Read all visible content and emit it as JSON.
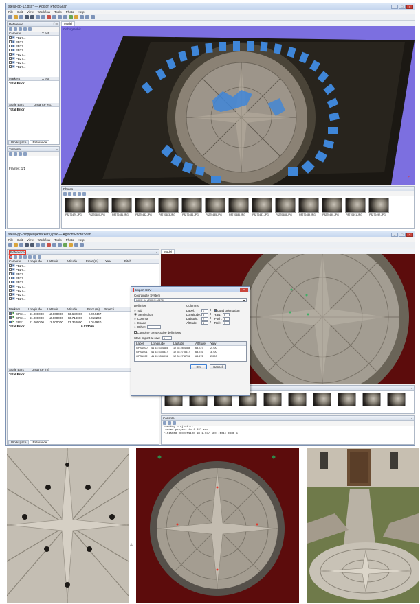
{
  "window1": {
    "title": "stella-pp-12.psx* — Agisoft PhotoScan",
    "menu": [
      "File",
      "Edit",
      "View",
      "Workflow",
      "Tools",
      "Photo",
      "Help"
    ],
    "reference_panel": {
      "title": "Reference",
      "cameras_header": [
        "Cameras",
        "X est"
      ],
      "cameras": [
        "PB27...",
        "PB27...",
        "PB27...",
        "PB27...",
        "PB27...",
        "PB27...",
        "PB27...",
        "PB27..."
      ],
      "markers_header": [
        "Markers",
        "X est"
      ],
      "total_error": "Total Error",
      "scale_header": [
        "Scale Bars",
        "Distance est."
      ],
      "scale_total": "Total Error",
      "tabs": [
        "Workspace",
        "Reference"
      ]
    },
    "timeline": {
      "title": "Timeline",
      "frames": "Frames: 1/1"
    },
    "model": {
      "tab": "Model",
      "label": "Orthographic"
    },
    "photos": {
      "title": "Photos",
      "files": [
        "P8270479.JPG",
        "P8270480.JPG",
        "P8270481.JPG",
        "P8270482.JPG",
        "P8270483.JPG",
        "P8270484.JPG",
        "P8270485.JPG",
        "P8270486.JPG",
        "P8270487.JPG",
        "P8270488.JPG",
        "P8270489.JPG",
        "P8270490.JPG",
        "P8270491.JPG",
        "P8270492.JPG"
      ]
    }
  },
  "window2": {
    "title": "stella-pp-cropped(4markers).psx — Agisoft PhotoScan",
    "reference_panel": {
      "title": "Reference",
      "cameras_columns": [
        "Cameras",
        "Longitude",
        "Latitude",
        "Altitude",
        "Error (m)",
        "Yaw",
        "Pitch"
      ],
      "cameras": [
        "PB27...",
        "PB27...",
        "PB27...",
        "PB27...",
        "PB27...",
        "PB27...",
        "PB27...",
        "PB27...",
        "PB27..."
      ],
      "markers_columns": [
        "Markers",
        "Longitude",
        "Latitude",
        "Altitude",
        "Error (m)",
        "Projecti"
      ],
      "markers": [
        {
          "name": "GPS1...",
          "lon": "41.000000",
          "lat": "12.000000",
          "alt": "63.682000",
          "err": "0.024447"
        },
        {
          "name": "GPS1...",
          "lon": "41.000000",
          "lat": "12.000000",
          "alt": "63.718000",
          "err": "0.018240"
        },
        {
          "name": "GPS1...",
          "lon": "41.000000",
          "lat": "12.000000",
          "alt": "63.362000",
          "err": "0.014940"
        }
      ],
      "total_error_label": "Total Error",
      "total_error_value": "0.023059",
      "scale_columns": [
        "Scale Bars",
        "Distance (m)"
      ],
      "scale_total": "Total Error",
      "tabs": [
        "Workspace",
        "Reference"
      ]
    },
    "model_tab": "Model",
    "console": {
      "title": "Console",
      "lines": [
        "Loading project...",
        "Loaded project in 1.037 sec",
        "Finished processing in 1.037 sec (exit code 1)"
      ]
    },
    "import_dialog": {
      "title": "Import CSV",
      "coordinate_system_label": "Coordinate System",
      "coordinate_system_value": "WGS 84 (EPSG::4326)",
      "delimiter_label": "Delimiter",
      "delimiters": [
        "Tab",
        "Semicolon",
        "Comma",
        "Space",
        "Other:"
      ],
      "combine_label": "Combine consecutive delimiters",
      "columns_label": "Columns",
      "columns": [
        {
          "label": "Label:",
          "value": "1",
          "right_label": "Load orientation",
          "right_value": ""
        },
        {
          "label": "Longitude:",
          "value": "3",
          "right_label": "Yaw:",
          "right_value": "5"
        },
        {
          "label": "Latitude:",
          "value": "2",
          "right_label": "Pitch:",
          "right_value": "6"
        },
        {
          "label": "Altitude:",
          "value": "4",
          "right_label": "Roll:",
          "right_value": "7"
        }
      ],
      "start_import_label": "Start import at row:",
      "start_import_value": "1",
      "table_columns": [
        "Label",
        "Longitude",
        "Latitude",
        "Altitude",
        "Yaw"
      ],
      "table_rows": [
        [
          "GPS1000",
          "41 53 53.4685",
          "12 28 28.4088",
          "63.727",
          "2.700"
        ],
        [
          "GPS1001",
          "41 53 53.5337",
          "12 28 27.5517",
          "63.746",
          "3.700"
        ],
        [
          "GPS1002",
          "41 53 53.6016",
          "12 28 27.8776",
          "63.672",
          "2.000"
        ]
      ],
      "ok": "OK",
      "cancel": "Cancel"
    }
  },
  "colors": {
    "point_cloud_bg": "#7c6fe0",
    "camera_blue": "#3f86d8",
    "dark_red_bg": "#5c0c0c",
    "highlight_red": "#e03a2e"
  },
  "footer_marker": "A"
}
